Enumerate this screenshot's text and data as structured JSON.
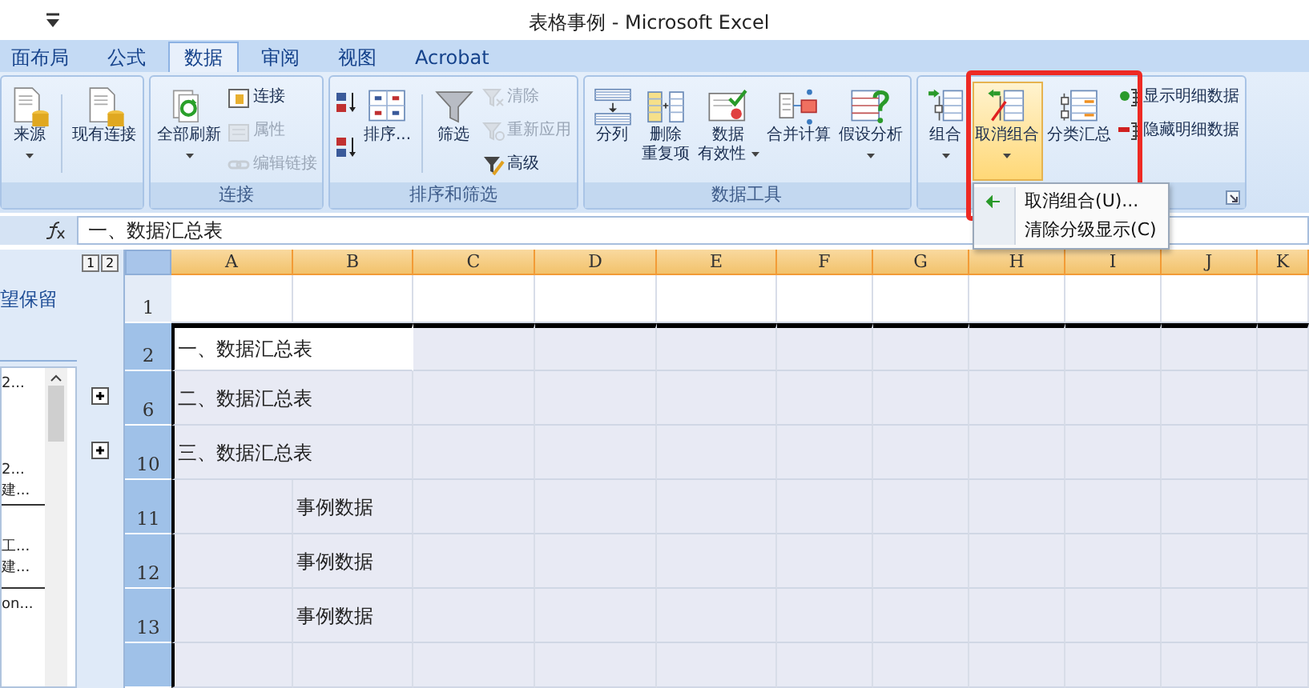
{
  "window": {
    "title": "表格事例 - Microsoft Excel"
  },
  "tabs": [
    {
      "label": "面布局",
      "selected": false
    },
    {
      "label": "公式",
      "selected": false
    },
    {
      "label": "数据",
      "selected": true
    },
    {
      "label": "审阅",
      "selected": false
    },
    {
      "label": "视图",
      "selected": false
    },
    {
      "label": "Acrobat",
      "selected": false
    }
  ],
  "ribbon": {
    "groups": [
      {
        "items": [
          {
            "kind": "large",
            "lines": [
              "来源"
            ],
            "dropdown": true
          },
          {
            "kind": "separator"
          },
          {
            "kind": "large",
            "lines": [
              "现有连接"
            ],
            "dropdown": false
          }
        ]
      },
      {
        "label": "连接",
        "items": [
          {
            "kind": "large",
            "lines": [
              "全部刷新"
            ],
            "dropdown": true
          },
          {
            "kind": "stack",
            "buttons": [
              {
                "label": "连接",
                "disabled": false
              },
              {
                "label": "属性",
                "disabled": true
              },
              {
                "label": "编辑链接",
                "disabled": true
              }
            ]
          }
        ]
      },
      {
        "label": "排序和筛选",
        "items": [
          {
            "kind": "stack",
            "buttons": [
              {
                "disabled": false
              },
              {
                "disabled": false
              }
            ]
          },
          {
            "kind": "large",
            "lines": [
              "排序..."
            ],
            "dropdown": false
          },
          {
            "kind": "separator"
          },
          {
            "kind": "large",
            "lines": [
              "筛选"
            ],
            "dropdown": false
          },
          {
            "kind": "stack",
            "buttons": [
              {
                "label": "清除",
                "disabled": true
              },
              {
                "label": "重新应用",
                "disabled": true
              },
              {
                "label": "高级",
                "disabled": false
              }
            ]
          }
        ]
      },
      {
        "label": "数据工具",
        "items": [
          {
            "kind": "large",
            "lines": [
              "分列"
            ],
            "dropdown": false
          },
          {
            "kind": "large",
            "lines": [
              "删除",
              "重复项"
            ],
            "dropdown": false
          },
          {
            "kind": "large",
            "lines": [
              "数据",
              "有效性"
            ],
            "dropdown": true
          },
          {
            "kind": "large",
            "lines": [
              "合并计算"
            ],
            "dropdown": false
          },
          {
            "kind": "large",
            "lines": [
              "假设分析"
            ],
            "dropdown": true
          }
        ]
      },
      {
        "launcher": true,
        "items": [
          {
            "kind": "large",
            "lines": [
              "组合"
            ],
            "dropdown": true,
            "pressed": false
          },
          {
            "kind": "large",
            "lines": [
              "取消组合"
            ],
            "dropdown": true,
            "pressed": true
          },
          {
            "kind": "large",
            "lines": [
              "分类汇总"
            ],
            "dropdown": false,
            "pressed": false
          },
          {
            "kind": "stack",
            "buttons": [
              {
                "label": "显示明细数据",
                "disabled": false
              },
              {
                "label": "隐藏明细数据",
                "disabled": false
              }
            ]
          }
        ]
      }
    ]
  },
  "menu": {
    "items": [
      {
        "label": "取消组合(U)..."
      },
      {
        "label": "清除分级显示(C)"
      }
    ]
  },
  "formula_bar": {
    "value": "一、数据汇总表"
  },
  "task_pane": {
    "text": "望保留",
    "groups": [
      {
        "items": [
          "2..."
        ],
        "rule": false
      },
      {
        "items": [
          "2...",
          "建..."
        ],
        "rule": true
      },
      {
        "items": [
          "工...",
          "建..."
        ],
        "rule": true
      },
      {
        "items": [
          "on..."
        ],
        "rule": false
      }
    ]
  },
  "outline": {
    "levels": [
      "1",
      "2"
    ]
  },
  "columns": [
    {
      "label": "A",
      "selected": true
    },
    {
      "label": "B",
      "selected": true
    },
    {
      "label": "C",
      "selected": true
    },
    {
      "label": "D",
      "selected": true
    },
    {
      "label": "E",
      "selected": true
    },
    {
      "label": "F",
      "selected": true
    },
    {
      "label": "G",
      "selected": true
    },
    {
      "label": "H",
      "selected": true
    },
    {
      "label": "I",
      "selected": true
    },
    {
      "label": "J",
      "selected": true
    },
    {
      "label": "K",
      "selected": true
    }
  ],
  "rows": [
    {
      "header": "1",
      "selected": false,
      "expander": false
    },
    {
      "header": "2",
      "selected": true,
      "expander": false,
      "active": true,
      "a": "一、数据汇总表"
    },
    {
      "header": "6",
      "selected": true,
      "expander": true,
      "a": "二、数据汇总表"
    },
    {
      "header": "10",
      "selected": true,
      "expander": true,
      "a": "三、数据汇总表"
    },
    {
      "header": "11",
      "selected": true,
      "expander": false,
      "b": "事例数据"
    },
    {
      "header": "12",
      "selected": true,
      "expander": false,
      "b": "事例数据"
    },
    {
      "header": "13",
      "selected": true,
      "expander": false,
      "b": "事例数据"
    },
    {
      "selected": true,
      "expander": false
    }
  ]
}
